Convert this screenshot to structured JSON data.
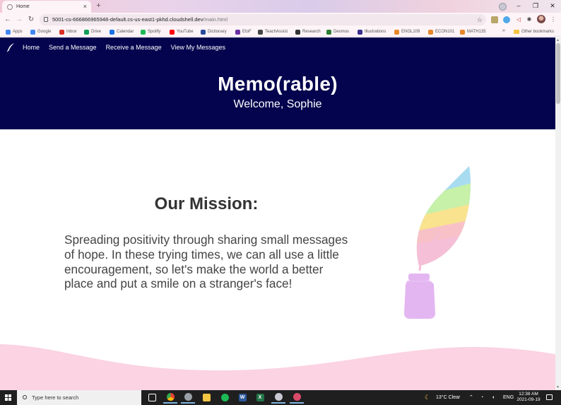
{
  "browser": {
    "tab_title": "Home",
    "tab_close": "×",
    "new_tab": "+",
    "url_host": "5001-cs-666866965948-default.cs-us-east1-pkhd.cloudshell.dev",
    "url_path": "/main.html",
    "window_minimize": "–",
    "window_restore": "❐",
    "window_close": "✕",
    "bookmarks": [
      {
        "label": "Apps",
        "icon": "apps-grid-icon",
        "color": "#4285f4"
      },
      {
        "label": "Google",
        "icon": "google-icon",
        "color": "#4285f4"
      },
      {
        "label": "Inbox",
        "icon": "gmail-icon",
        "color": "#d93025"
      },
      {
        "label": "Drive",
        "icon": "drive-icon",
        "color": "#0f9d58"
      },
      {
        "label": "Calendar",
        "icon": "calendar-icon",
        "color": "#1a73e8"
      },
      {
        "label": "Spotify",
        "icon": "spotify-icon",
        "color": "#1db954"
      },
      {
        "label": "YouTube",
        "icon": "youtube-icon",
        "color": "#ff0000"
      },
      {
        "label": "Dictionary",
        "icon": "dictionary-icon",
        "color": "#2a4a9a"
      },
      {
        "label": "EtoF",
        "icon": "wordreference-icon",
        "color": "#6b2fa0"
      },
      {
        "label": "TeachAssist",
        "icon": "teachassist-icon",
        "color": "#444444"
      },
      {
        "label": "Research",
        "icon": "research-icon",
        "color": "#333333"
      },
      {
        "label": "Desmos",
        "icon": "desmos-icon",
        "color": "#2f7d32"
      },
      {
        "label": "Illustrations",
        "icon": "illustrations-icon",
        "color": "#3b2f8f"
      },
      {
        "label": "ENGL109",
        "icon": "course-icon",
        "color": "#e8872b"
      },
      {
        "label": "ECON101",
        "icon": "course-icon",
        "color": "#e8872b"
      },
      {
        "label": "MATH135",
        "icon": "course-icon",
        "color": "#e8872b"
      }
    ],
    "bookmarks_more": "»",
    "other_bookmarks": "Other bookmarks"
  },
  "site": {
    "nav": [
      {
        "label": "Home"
      },
      {
        "label": "Send a Message"
      },
      {
        "label": "Receive a Message"
      },
      {
        "label": "View My Messages"
      }
    ],
    "title": "Memo(rable)",
    "welcome": "Welcome, Sophie",
    "mission_heading": "Our Mission:",
    "mission_text": "Spreading positivity through sharing small messages of hope. In these trying times, we can all use a little encouragement, so let's make the world a better place and put a smile on a stranger's face!",
    "colors": {
      "header_bg": "#03034e",
      "wave": "#fbd3e2",
      "quill": [
        "#f6bfd8",
        "#f8c1c8",
        "#f9e38f",
        "#c7f0a8",
        "#a7dcf0",
        "#b9c8f5"
      ],
      "ink_bottle": "#e3b6f2"
    }
  },
  "taskbar": {
    "search_placeholder": "Type here to search",
    "apps": [
      "task-view-icon",
      "chrome-icon",
      "chrome-alt-icon",
      "file-explorer-icon",
      "spotify-icon",
      "word-icon",
      "excel-icon",
      "chrome-profile-icon",
      "chrome-profile2-icon"
    ],
    "weather": "13°C  Clear",
    "language": "ENG",
    "time": "12:38 AM",
    "date": "2021-09-19"
  }
}
